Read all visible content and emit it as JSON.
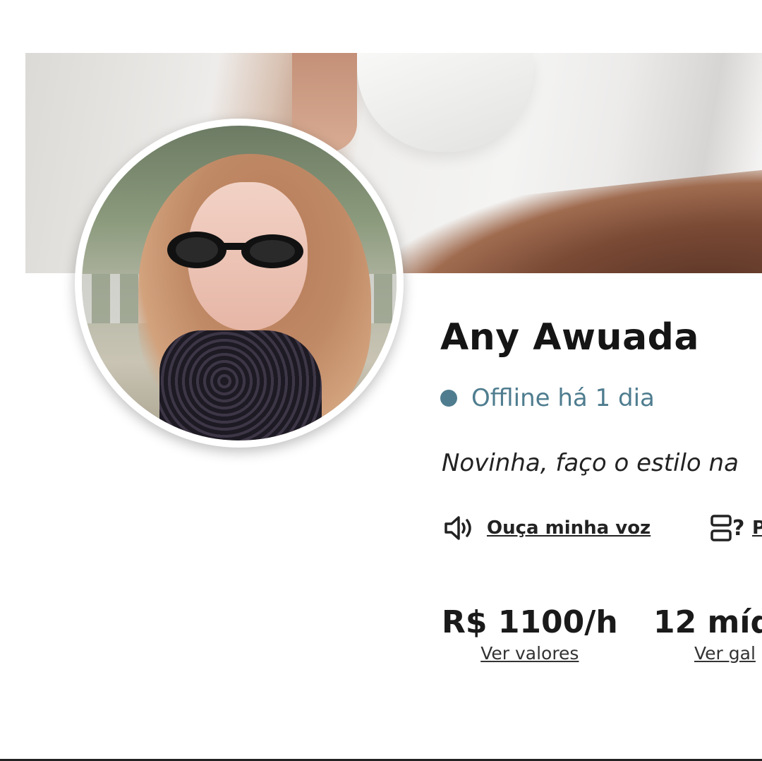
{
  "profile": {
    "name": "Any Awuada",
    "status_text": "Offline há 1 dia",
    "status_color": "#4f7d8f",
    "bio": "Novinha, faço o estilo na",
    "voice_label": "Ouça minha voz",
    "faq_label": "P"
  },
  "stats": [
    {
      "value": "R$ 1100/h",
      "link": "Ver valores"
    },
    {
      "value": "12 míd",
      "link": "Ver gal"
    }
  ],
  "icons": {
    "voice": "speaker-icon",
    "faq": "faq-icon"
  }
}
